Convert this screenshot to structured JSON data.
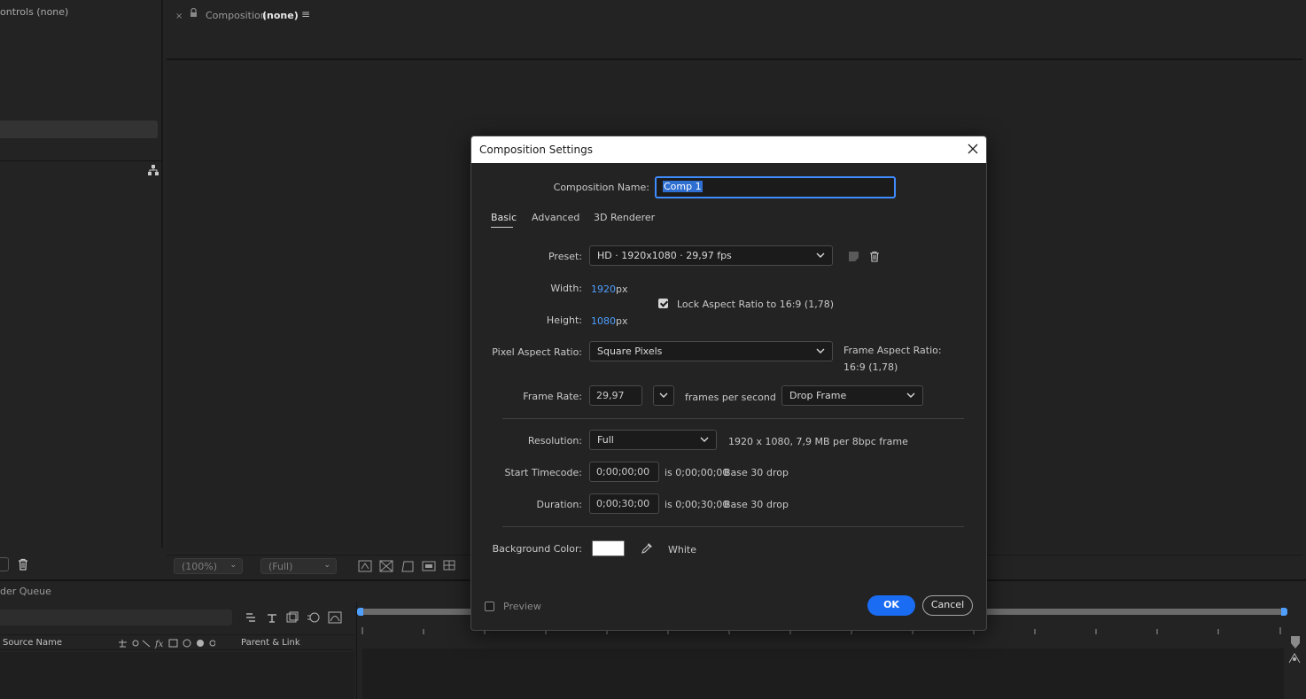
{
  "left_panel": {
    "title": "Controls (none)",
    "title_visible": "ontrols (none)"
  },
  "composition_panel": {
    "tab_close": "×",
    "tab_label": "Composition",
    "tab_name": "(none)",
    "tab_menu": "≡"
  },
  "viewer_toolbar": {
    "zoom": "(100%)",
    "resolution": "(Full)"
  },
  "timeline": {
    "tab_label": "der Queue",
    "col_source_name": "Source Name",
    "col_parent_link": "Parent & Link"
  },
  "dialog": {
    "title": "Composition Settings",
    "comp_name_label": "Composition Name:",
    "comp_name_value": "Comp 1",
    "tabs": [
      {
        "label": "Basic",
        "active": true
      },
      {
        "label": "Advanced",
        "active": false
      },
      {
        "label": "3D Renderer",
        "active": false
      }
    ],
    "preset_label": "Preset:",
    "preset_value": "HD · 1920x1080 · 29,97 fps",
    "width_label": "Width:",
    "width_value": "1920",
    "width_unit": "px",
    "height_label": "Height:",
    "height_value": "1080",
    "height_unit": "px",
    "lock_aspect_label": "Lock Aspect Ratio to 16:9 (1,78)",
    "lock_aspect_checked": true,
    "pixel_aspect_label": "Pixel Aspect Ratio:",
    "pixel_aspect_value": "Square Pixels",
    "frame_aspect_label": "Frame Aspect Ratio:",
    "frame_aspect_value": "16:9 (1,78)",
    "frame_rate_label": "Frame Rate:",
    "frame_rate_value": "29,97",
    "frame_rate_unit": "frames per second",
    "drop_frame_value": "Drop Frame",
    "resolution_label": "Resolution:",
    "resolution_value": "Full",
    "resolution_info": "1920 x 1080, 7,9 MB per 8bpc frame",
    "start_tc_label": "Start Timecode:",
    "start_tc_value": "0;00;00;00",
    "start_tc_is": "is 0;00;00;00",
    "start_tc_base": "Base 30",
    "start_tc_drop": "drop",
    "duration_label": "Duration:",
    "duration_value": "0;00;30;00",
    "duration_is": "is 0;00;30;00",
    "duration_base": "Base 30",
    "duration_drop": "drop",
    "bg_color_label": "Background Color:",
    "bg_color_hex": "#ffffff",
    "bg_color_name": "White",
    "preview_label": "Preview",
    "preview_checked": false,
    "ok_label": "OK",
    "cancel_label": "Cancel"
  },
  "colors": {
    "accent": "#1a6cf2",
    "link_blue": "#4f9fff",
    "background": "#232323"
  }
}
